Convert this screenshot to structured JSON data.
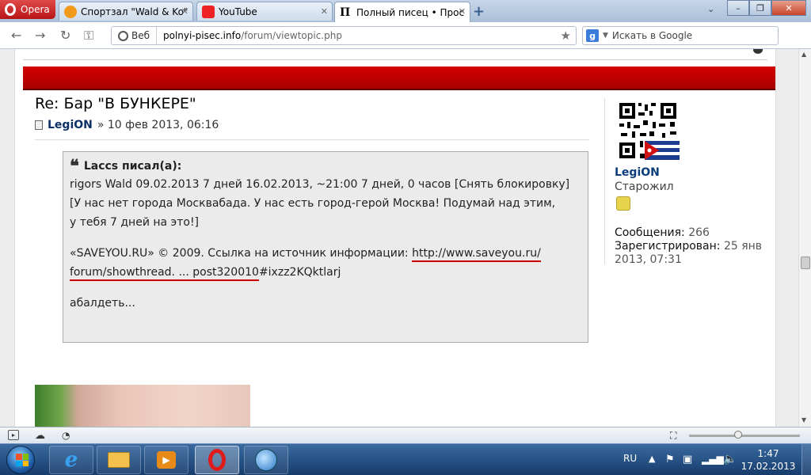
{
  "browser": {
    "menu_label": "Opera",
    "tabs": [
      {
        "title": "Спортзал \"Wald & Ko\" ..."
      },
      {
        "title": "YouTube"
      },
      {
        "title": "Полный писец • Прос..."
      }
    ],
    "window_controls": {
      "minimize": "–",
      "restore": "❐",
      "close": "✕"
    }
  },
  "address_bar": {
    "security_label": "Веб",
    "url_host": "polnyi-pisec.info",
    "url_path": "/forum/viewtopic.php",
    "search_placeholder": "Искать в Google"
  },
  "post": {
    "title": "Re: Бар \"В БУНКЕРЕ\"",
    "author": "LegiON",
    "date": "» 10 фев 2013, 06:16",
    "quote": {
      "header": "Laccs писал(а):",
      "line1": "rigors Wald 09.02.2013 7 дней 16.02.2013, ~21:00 7 дней, 0 часов [Снять блокировку]",
      "line2": "[У нас нет города Москвабада. У нас есть город-герой Москва! Подумай над этим,",
      "line3": "у тебя 7 дней на это!]",
      "source_prefix": "«SAVEYOU.RU» © 2009. Ссылка на источник информации: ",
      "link_part1": "http://www.saveyou.ru/",
      "link_part2": "forum/showthread. ... post320010",
      "link_tail": "#ixzz2KQktlarj",
      "trailer": "абалдеть..."
    }
  },
  "profile": {
    "name": "LegiON",
    "rank": "Старожил",
    "messages_label": "Сообщения:",
    "messages_value": "266",
    "registered_label": "Зарегистрирован:",
    "registered_value": "25 янв",
    "registered_value_2": "2013, 07:31"
  },
  "taskbar": {
    "language": "RU",
    "time": "1:47",
    "date": "17.02.2013"
  },
  "colors": {
    "forum_band": "#c00000",
    "author_link": "#0b2f66",
    "link_underline": "#cc0000"
  }
}
